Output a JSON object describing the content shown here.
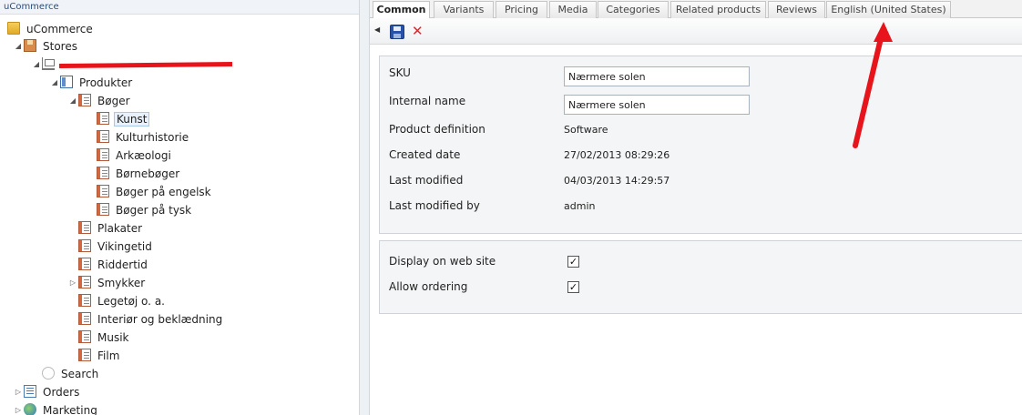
{
  "tree": {
    "header": "uCommerce",
    "nodes": [
      {
        "label": "uCommerce"
      },
      {
        "label": "Stores"
      },
      {
        "label": ""
      },
      {
        "label": "Produkter"
      },
      {
        "label": "Bøger"
      },
      {
        "label": "Kunst"
      },
      {
        "label": "Kulturhistorie"
      },
      {
        "label": "Arkæologi"
      },
      {
        "label": "Børnebøger"
      },
      {
        "label": "Bøger på engelsk"
      },
      {
        "label": "Bøger på tysk"
      },
      {
        "label": "Plakater"
      },
      {
        "label": "Vikingetid"
      },
      {
        "label": "Riddertid"
      },
      {
        "label": "Smykker"
      },
      {
        "label": "Legetøj o. a."
      },
      {
        "label": "Interiør og beklædning"
      },
      {
        "label": "Musik"
      },
      {
        "label": "Film"
      },
      {
        "label": "Search"
      },
      {
        "label": "Orders"
      },
      {
        "label": "Marketing"
      }
    ],
    "selected": "Kunst"
  },
  "tabs": [
    {
      "label": "Common"
    },
    {
      "label": "Variants"
    },
    {
      "label": "Pricing"
    },
    {
      "label": "Media"
    },
    {
      "label": "Categories"
    },
    {
      "label": "Related products"
    },
    {
      "label": "Reviews"
    },
    {
      "label": "English (United States)"
    }
  ],
  "active_tab": "Common",
  "toolbar": {
    "icons": [
      "back-arrow-icon",
      "save-icon",
      "delete-icon"
    ]
  },
  "product": {
    "sku_label": "SKU",
    "sku_value": "Nærmere solen",
    "internal_name_label": "Internal name",
    "internal_name_value": "Nærmere solen",
    "definition_label": "Product definition",
    "definition_value": "Software",
    "created_label": "Created date",
    "created_value": "27/02/2013 08:29:26",
    "modified_label": "Last modified",
    "modified_value": "04/03/2013 14:29:57",
    "modified_by_label": "Last modified by",
    "modified_by_value": "admin"
  },
  "display": {
    "web_label": "Display on web site",
    "web_checked": true,
    "ordering_label": "Allow ordering",
    "ordering_checked": true
  },
  "colors": {
    "annotation_red": "#e8141c",
    "accent_blue": "#2752a8"
  }
}
